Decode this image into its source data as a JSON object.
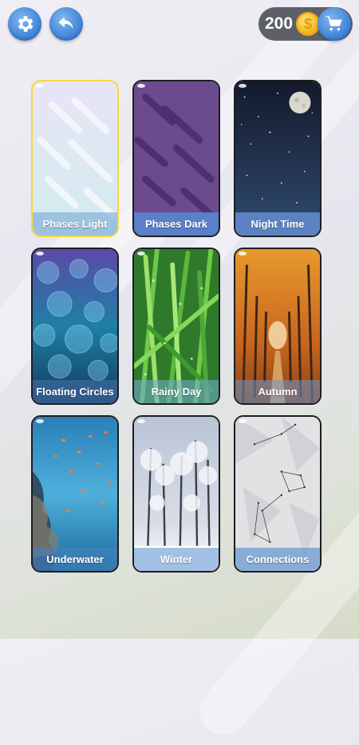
{
  "header": {
    "settings_icon": "gear-icon",
    "back_icon": "undo-arrow-icon",
    "coins": "200",
    "coin_icon": "dollar-coin-icon",
    "coin_symbol": "$",
    "cart_icon": "shopping-cart-icon"
  },
  "colors": {
    "button_blue": "#3a7fd6",
    "label_blue": "#5b8fd0",
    "selected_border": "#f5d83a",
    "coin_gold": "#f2b21a"
  },
  "themes": [
    {
      "label": "Phases Light",
      "selected": true
    },
    {
      "label": "Phases Dark",
      "selected": false
    },
    {
      "label": "Night Time",
      "selected": false
    },
    {
      "label": "Floating Circles",
      "selected": false
    },
    {
      "label": "Rainy Day",
      "selected": false
    },
    {
      "label": "Autumn",
      "selected": false
    },
    {
      "label": "Underwater",
      "selected": false
    },
    {
      "label": "Winter",
      "selected": false
    },
    {
      "label": "Connections",
      "selected": false
    }
  ]
}
